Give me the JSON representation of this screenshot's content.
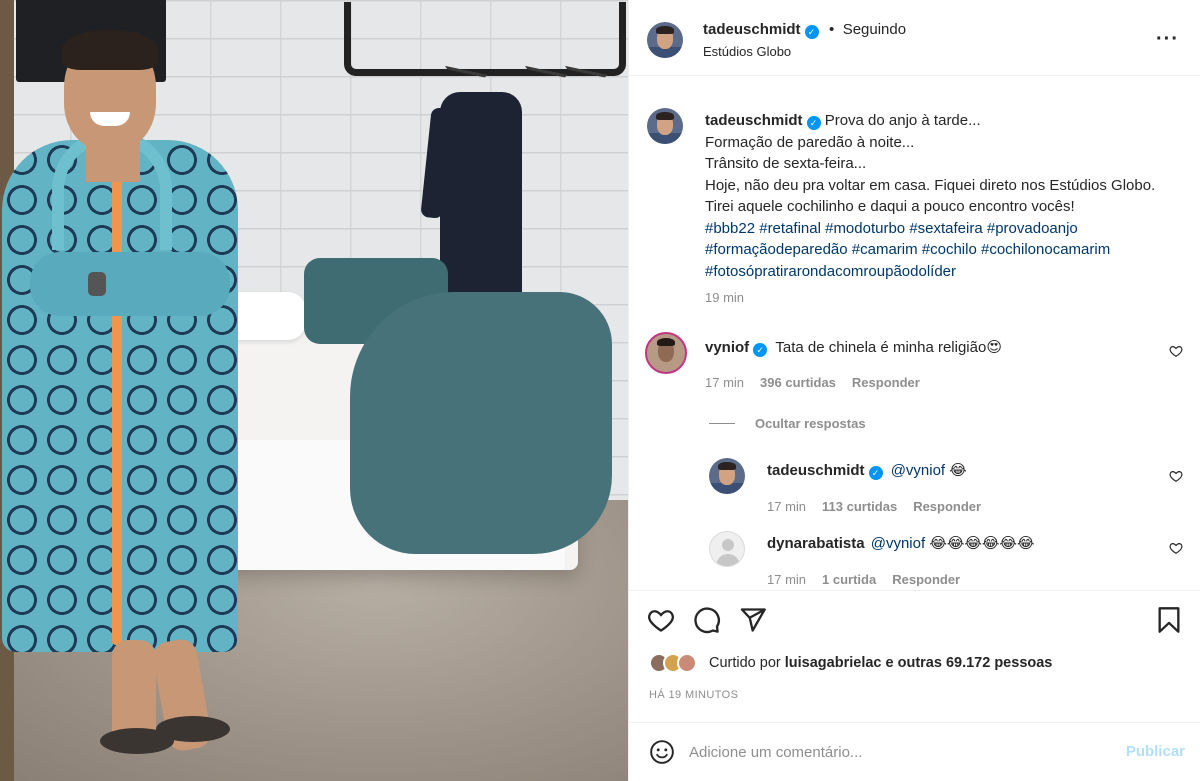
{
  "post": {
    "author": "tadeuschmidt",
    "follow_status": "Seguindo",
    "separator": "•",
    "location": "Estúdios Globo",
    "more_icon": "···",
    "verified_icon": "✓"
  },
  "caption": {
    "author": "tadeuschmidt",
    "lines": [
      "Prova do anjo à tarde...",
      "Formação de paredão à noite...",
      "Trânsito de sexta-feira...",
      "Hoje, não deu pra voltar em casa. Fiquei direto nos Estúdios Globo.",
      "Tirei aquele cochilinho e daqui a pouco encontro vocês!"
    ],
    "hashtag_lines": [
      "#bbb22 #retafinal #modoturbo #sextafeira #provadoanjo",
      "#formaçãodeparedão #camarim #cochilo #cochilonocamarim",
      "#fotosópratirarondacomroupãodolíder"
    ],
    "time": "19 min"
  },
  "comments": [
    {
      "user": "vyniof",
      "verified": true,
      "text": "Tata de chinela é minha religião😍",
      "time": "17 min",
      "likes": "396 curtidas",
      "reply": "Responder"
    }
  ],
  "hide_replies": "Ocultar respostas",
  "replies": [
    {
      "user": "tadeuschmidt",
      "verified": true,
      "mention": "@vyniof",
      "text": "😂",
      "time": "17 min",
      "likes": "113 curtidas",
      "reply": "Responder"
    },
    {
      "user": "dynarabatista",
      "verified": false,
      "mention": "@vyniof",
      "text": "😂😂😂😂😂😂",
      "time": "17 min",
      "likes": "1 curtida",
      "reply": "Responder"
    }
  ],
  "likes": {
    "prefix": "Curtido por",
    "user": "luisagabrielac",
    "suffix": "e outras 69.172 pessoas"
  },
  "time_ago": "HÁ 19 MINUTOS",
  "comment_input": {
    "placeholder": "Adicione um comentário...",
    "publish": "Publicar"
  },
  "colors": {
    "accent": "#0095f6",
    "publish_disabled": "#b2dffc",
    "hashtag": "#00376b",
    "muted": "#8e8e8e"
  },
  "icons": [
    "heart-icon",
    "comment-icon",
    "share-icon",
    "bookmark-icon",
    "emoji-icon",
    "more-icon",
    "verified-icon"
  ]
}
